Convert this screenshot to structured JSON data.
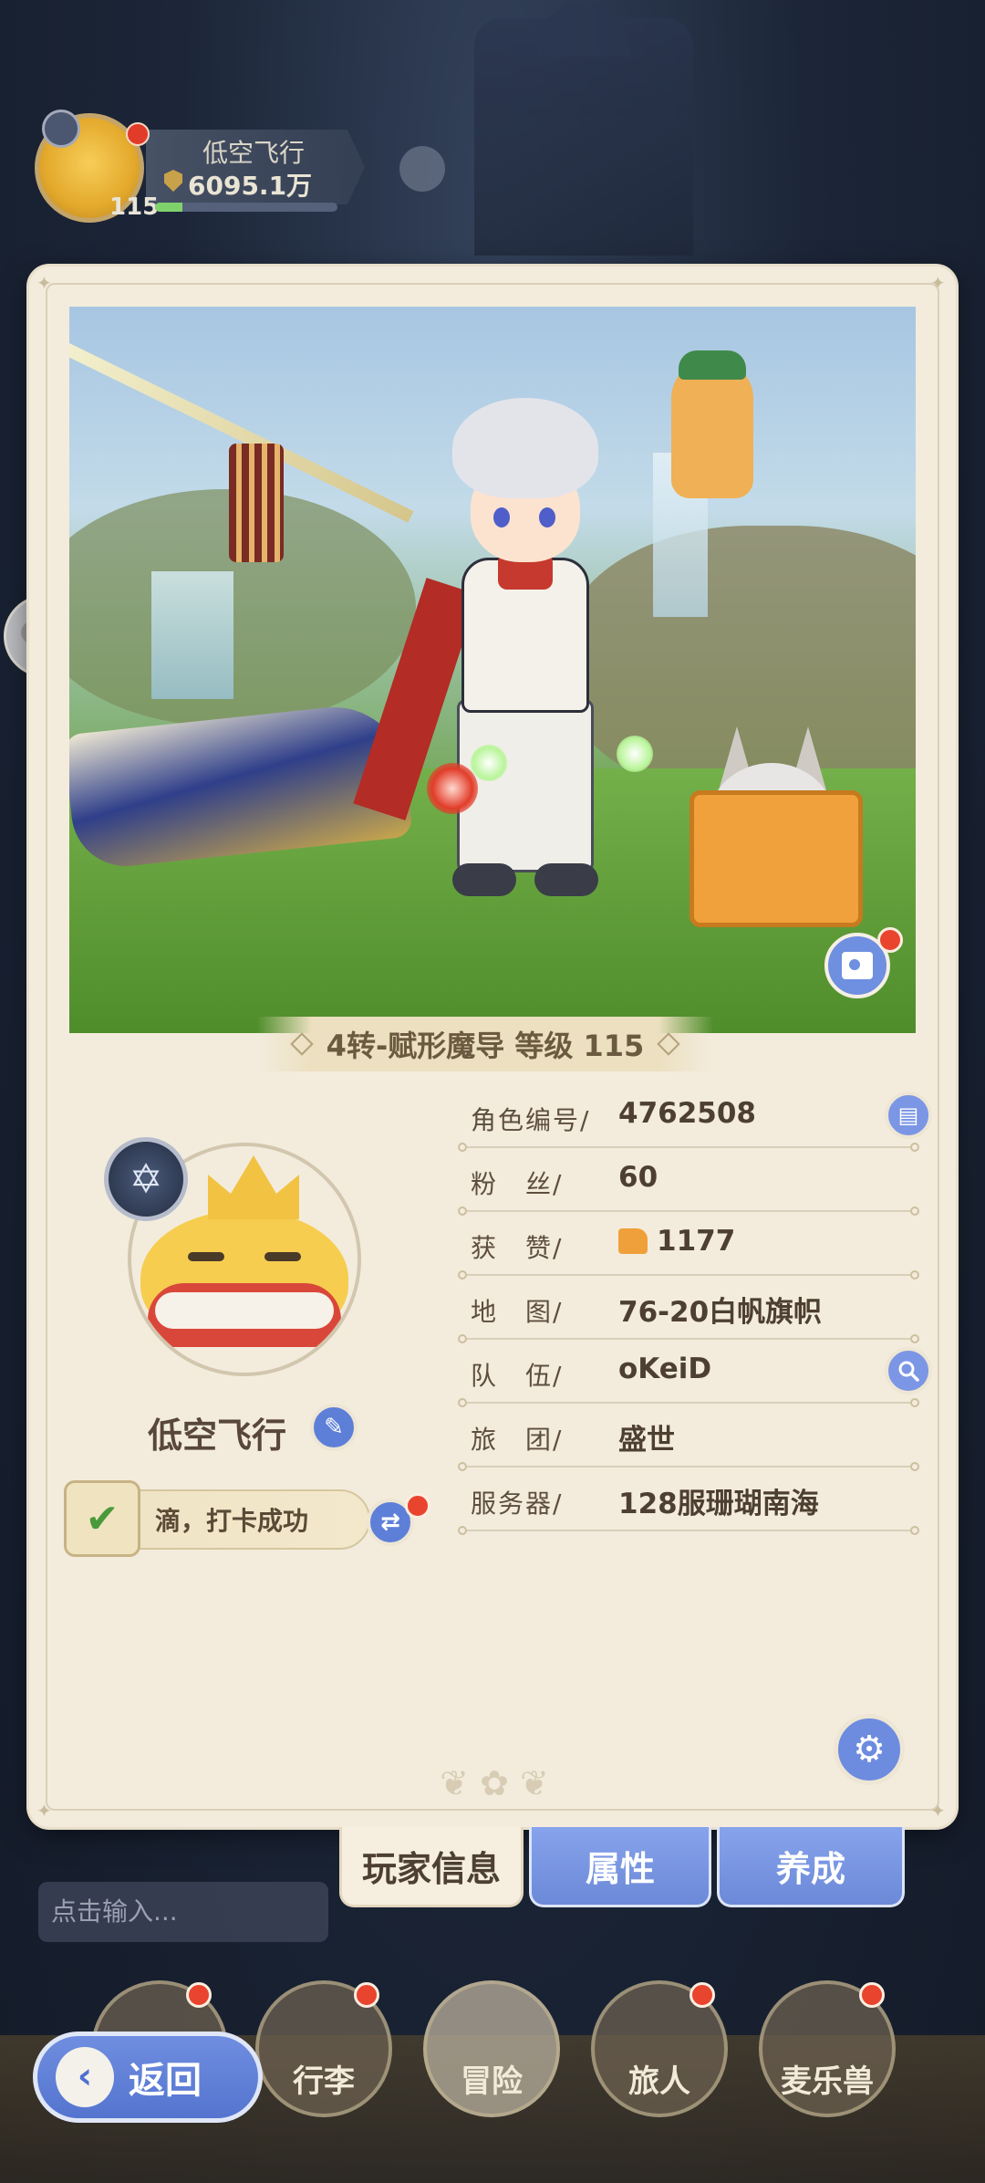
{
  "top_player": {
    "name": "低空飞行",
    "power": "6095.1万",
    "level": "115",
    "exp_fraction": 0.15
  },
  "scene": {
    "class_title": "4转-赋形魔导 等级 115"
  },
  "profile": {
    "name": "低空飞行",
    "checkin_text": "滴，打卡成功",
    "rows": [
      {
        "label": "角色编号/",
        "value": "4762508",
        "button": "copy-icon"
      },
      {
        "label": "粉　丝/",
        "value": "60"
      },
      {
        "label": "获　赞/",
        "value": "1177",
        "icon": "thumbs-up-icon"
      },
      {
        "label": "地　图/",
        "value": "76-20白帆旗帜"
      },
      {
        "label": "队　伍/",
        "value": "oKeiD",
        "button": "search-icon"
      },
      {
        "label": "旅　团/",
        "value": "盛世"
      },
      {
        "label": "服务器/",
        "value": "128服珊瑚南海"
      }
    ]
  },
  "tabs": [
    {
      "label": "玩家信息",
      "active": true
    },
    {
      "label": "属性",
      "active": false
    },
    {
      "label": "养成",
      "active": false
    }
  ],
  "chat": {
    "placeholder": "点击输入..."
  },
  "bottom_nav": {
    "back_label": "返回",
    "items": [
      {
        "label": "行李"
      },
      {
        "label": "冒险"
      },
      {
        "label": "旅人"
      },
      {
        "label": "麦乐兽"
      }
    ]
  },
  "colors": {
    "card_bg": "#f3ecdd",
    "accent_blue": "#6d8ce0",
    "red_dot": "#e8442e",
    "text_brown": "#4d3f31"
  }
}
